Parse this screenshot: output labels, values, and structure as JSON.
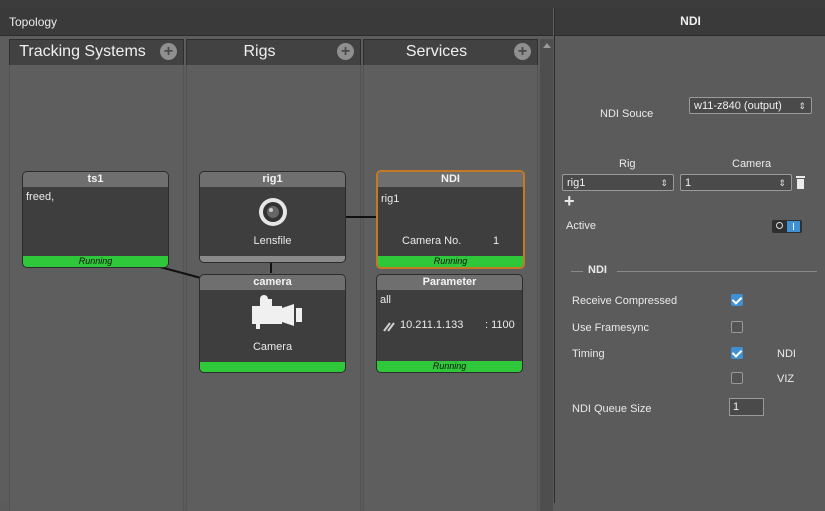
{
  "topology": {
    "title": "Topology",
    "columns": [
      {
        "label": "Tracking Systems"
      },
      {
        "label": "Rigs"
      },
      {
        "label": "Services"
      }
    ],
    "nodes": {
      "ts1": {
        "title": "ts1",
        "body": "freed,",
        "status": "Running"
      },
      "rig1": {
        "title": "rig1",
        "sub": "Lensfile"
      },
      "camera": {
        "title": "camera",
        "sub": "Camera"
      },
      "ndi": {
        "title": "NDI",
        "rig": "rig1",
        "field_label": "Camera No.",
        "field_value": "1",
        "status": "Running"
      },
      "parameter": {
        "title": "Parameter",
        "body": "all",
        "address": "10.211.1.133",
        "port": ": 1100",
        "status": "Running"
      }
    }
  },
  "ndi_panel": {
    "title": "NDI",
    "source_label": "NDI Souce",
    "source_value": "w11-z840 (output)",
    "rig_header": "Rig",
    "camera_header": "Camera",
    "rig_value": "rig1",
    "camera_value": "1",
    "add_symbol": "+",
    "active_label": "Active",
    "active_on": true,
    "section_label": "NDI",
    "receive_compressed_label": "Receive Compressed",
    "receive_compressed": true,
    "use_framesync_label": "Use Framesync",
    "use_framesync": false,
    "timing_label": "Timing",
    "timing_ndi_label": "NDI",
    "timing_ndi": true,
    "timing_viz_label": "VIZ",
    "timing_viz": false,
    "queue_size_label": "NDI Queue Size",
    "queue_size_value": "1"
  },
  "colors": {
    "running": "#2fc83b",
    "selected_border": "#c47a22",
    "checkbox": "#3f8fd3"
  },
  "icons": [
    "plus-circle-icon",
    "lens-icon",
    "camera-icon",
    "link-icon",
    "trash-icon",
    "chevron-updown-icon",
    "toggle-icon"
  ]
}
